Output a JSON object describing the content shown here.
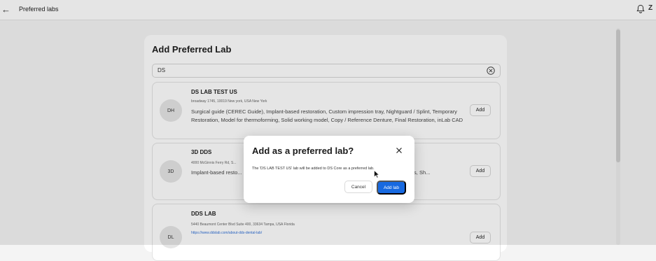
{
  "header": {
    "back_icon": "arrow-left-icon",
    "title": "Preferred labs",
    "avatar_initial": "Z"
  },
  "panel": {
    "title": "Add Preferred Lab",
    "search": {
      "value": "DS",
      "clear_icon": "circle-x-icon"
    },
    "labs": [
      {
        "initials": "DH",
        "name": "DS LAB TEST US",
        "address": "broadway 1745, 10019 New york, USA New York",
        "link": "",
        "services": "Surgical guide (CEREC Guide), Implant-based restoration, Custom impression tray, Nightguard / Splint, Temporary Restoration, Model for thermoforming, Solid working model, Copy / Reference Denture, Final Restoration, inLab CAD",
        "add_label": "Add"
      },
      {
        "initials": "3D",
        "name": "3D DDS",
        "address": "4000 McGinnis Ferry Rd, S...",
        "link": "",
        "services": "Implant-based resto...                                   ...storation, Model for thermoforming, S...                                   ...Exocad CAD, Material Classes, Sh...",
        "add_label": "Add"
      },
      {
        "initials": "DL",
        "name": "DDS LAB",
        "address": "5440 Beaumont Center Blvd Suite 400, 33634 Tampa, USA Florida",
        "link": "https://www.ddslab.com/about-dds-dental-lab/",
        "services": "",
        "add_label": "Add"
      }
    ]
  },
  "dialog": {
    "title": "Add as a preferred lab?",
    "message": "The 'DS LAB TEST US' lab will be added to DS Core as a preferred lab.",
    "cancel_label": "Cancel",
    "confirm_label": "Add lab",
    "close_icon": "close-icon"
  },
  "colors": {
    "primary": "#1769e0",
    "link": "#2f6fd6",
    "overlay": "rgba(0,0,0,0.10)"
  }
}
